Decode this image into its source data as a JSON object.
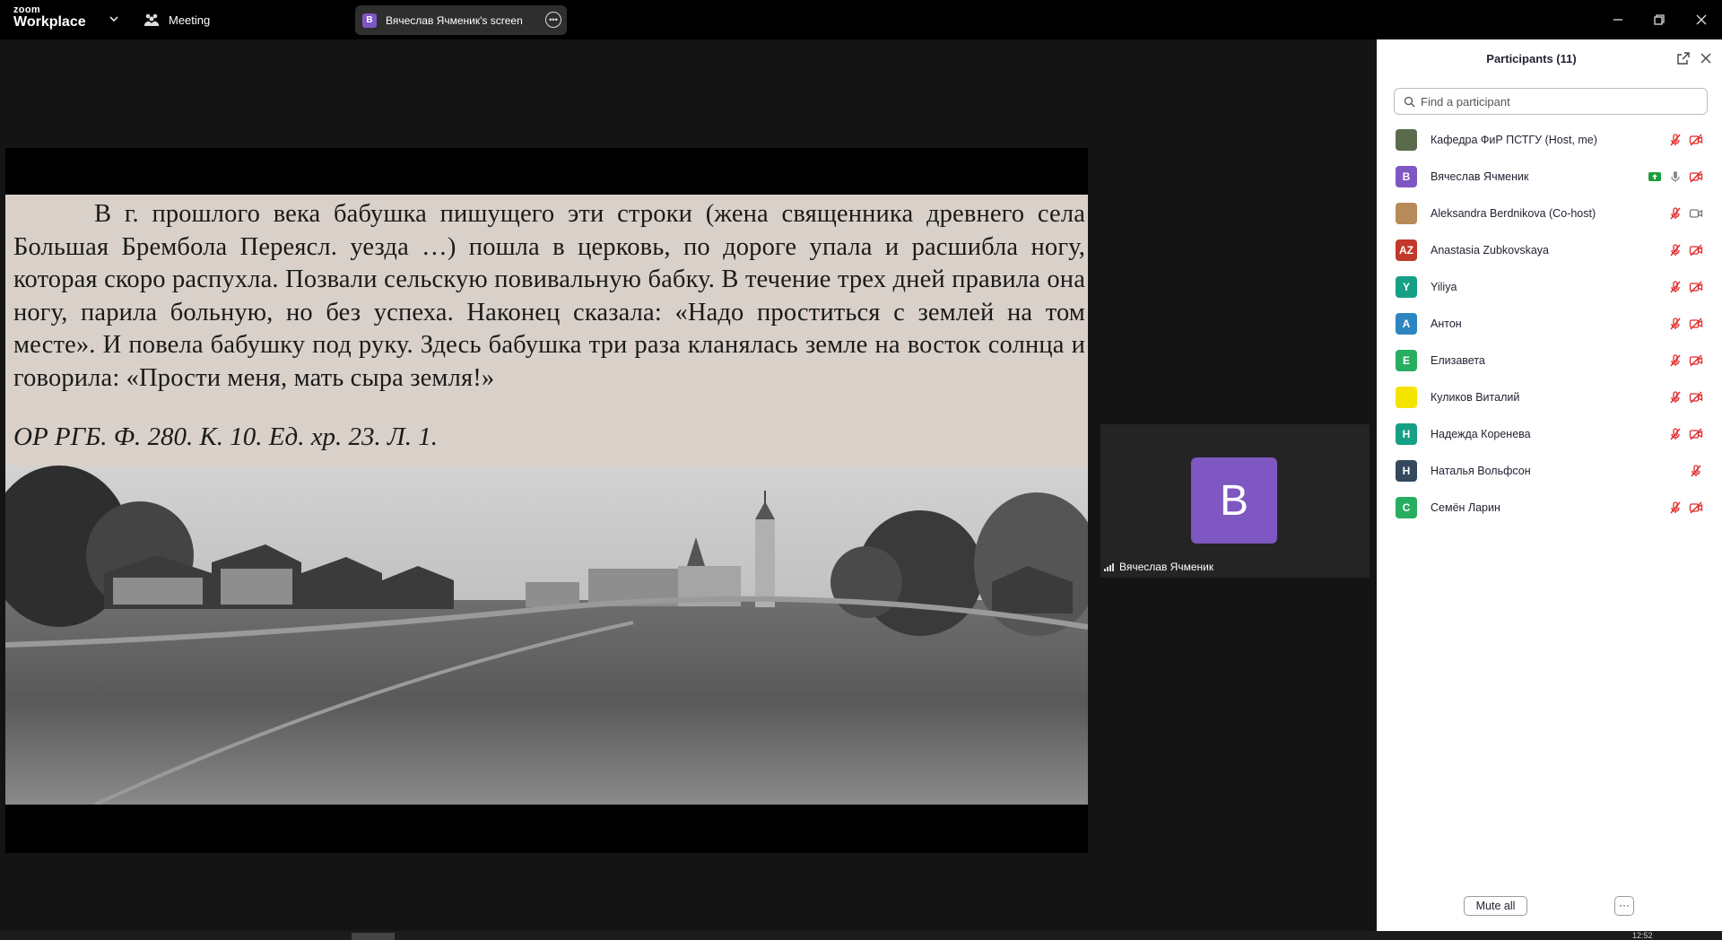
{
  "app": {
    "logo_small": "zoom",
    "logo_big": "Workplace",
    "meeting_label": "Meeting",
    "share_initial": "B",
    "share_label": "Вячеслав Ячменик's screen"
  },
  "slide": {
    "paragraph": "В г. прошлого века бабушка пишущего эти строки (жена священника древнего села Большая Брембола Переясл. уезда …) пошла в церковь, по дороге упала и расшибла ногу, которая скоро распухла. Позвали сельскую повивальную бабку. В течение трех дней правила она ногу, парила больную, но без успеха. Наконец сказала: «Надо проститься с землей на том месте». И повела бабушку под руку. Здесь бабушка три раза кланялась земле на восток солнца и говорила: «Прости меня, мать сыра земля!»",
    "reference": "ОР РГБ. Ф. 280. К. 10. Ед. хр. 23. Л. 1."
  },
  "video_tile": {
    "initial": "B",
    "name": "Вячеслав Ячменик"
  },
  "panel": {
    "title": "Participants (11)",
    "search_placeholder": "Find a participant",
    "mute_all": "Mute all",
    "more": "···",
    "participants": [
      {
        "name": "Кафедра ФиР ПСТГУ (Host, me)",
        "initial": "",
        "color": "#5a6b4c",
        "mic": "muted",
        "video": "off"
      },
      {
        "name": "Вячеслав Ячменик",
        "initial": "B",
        "color": "#7e57c2",
        "mic": "on",
        "video": "off",
        "sharing": true
      },
      {
        "name": "Aleksandra Berdnikova (Co-host)",
        "initial": "",
        "color": "#b88a5a",
        "mic": "muted",
        "video": "on"
      },
      {
        "name": "Anastasia Zubkovskaya",
        "initial": "AZ",
        "color": "#c0392b",
        "mic": "muted",
        "video": "off"
      },
      {
        "name": "Yiliya",
        "initial": "Y",
        "color": "#16a085",
        "mic": "muted",
        "video": "off"
      },
      {
        "name": "Антон",
        "initial": "А",
        "color": "#2e86c1",
        "mic": "muted",
        "video": "off"
      },
      {
        "name": "Елизавета",
        "initial": "Е",
        "color": "#27ae60",
        "mic": "muted",
        "video": "off"
      },
      {
        "name": "Куликов Виталий",
        "initial": "",
        "color": "#f5e400",
        "mic": "muted",
        "video": "off"
      },
      {
        "name": "Надежда Коренева",
        "initial": "Н",
        "color": "#16a085",
        "mic": "muted",
        "video": "off"
      },
      {
        "name": "Наталья Вольфсон",
        "initial": "Н",
        "color": "#34495e",
        "mic": "muted",
        "video": "none"
      },
      {
        "name": "Семён Ларин",
        "initial": "С",
        "color": "#27ae60",
        "mic": "muted",
        "video": "off"
      }
    ]
  },
  "taskbar": {
    "clock": "12:52"
  }
}
